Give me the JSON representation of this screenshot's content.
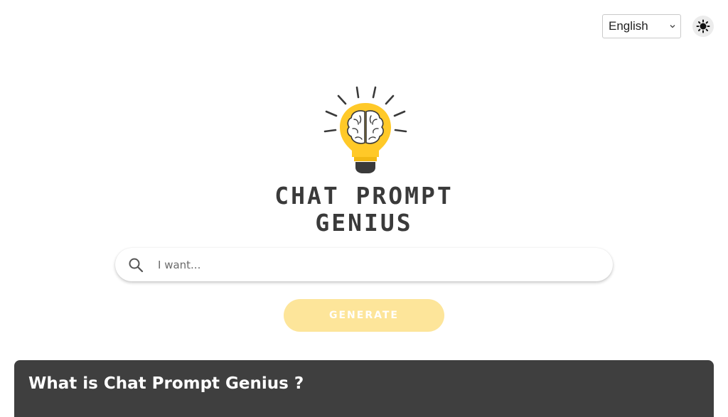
{
  "header": {
    "language": {
      "selected": "English"
    },
    "theme_toggle": {
      "icon": "sun-icon"
    }
  },
  "logo": {
    "icon": "lightbulb-brain-icon",
    "title_line1": "CHAT PROMPT",
    "title_line2": "GENIUS"
  },
  "search": {
    "icon": "search-icon",
    "placeholder": "I want...",
    "value": ""
  },
  "generate_button": {
    "label": "GENERATE"
  },
  "info": {
    "title": "What is Chat Prompt Genius ?"
  },
  "colors": {
    "accent": "#FFC928",
    "button_disabled": "#FDE59A",
    "title": "#3A3A3A",
    "card": "#3F3F3F"
  }
}
